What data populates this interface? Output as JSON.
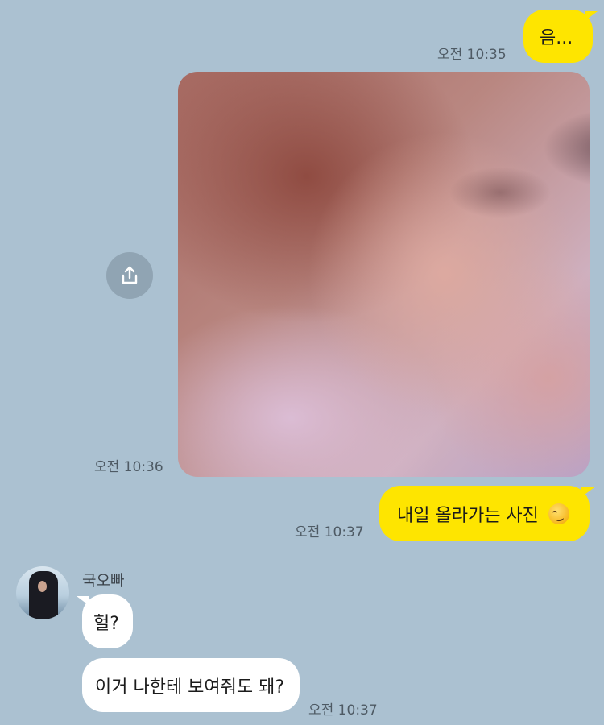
{
  "messages": {
    "m1": {
      "text": "음...",
      "time": "오전 10:35"
    },
    "photo": {
      "time": "오전 10:36"
    },
    "m2": {
      "text": "내일 올라가는 사진",
      "emoji": "smirking-face",
      "time": "오전 10:37"
    },
    "other": {
      "sender": "국오빠",
      "m1": {
        "text": "헐?"
      },
      "m2": {
        "text": "이거 나한테 보여줘도 돼?",
        "time": "오전 10:37"
      }
    }
  },
  "icons": {
    "share": "share-icon",
    "avatar": "avatar"
  },
  "colors": {
    "background": "#abc1d1",
    "my_bubble": "#fee500",
    "other_bubble": "#ffffff",
    "timestamp": "#4e5a64"
  }
}
